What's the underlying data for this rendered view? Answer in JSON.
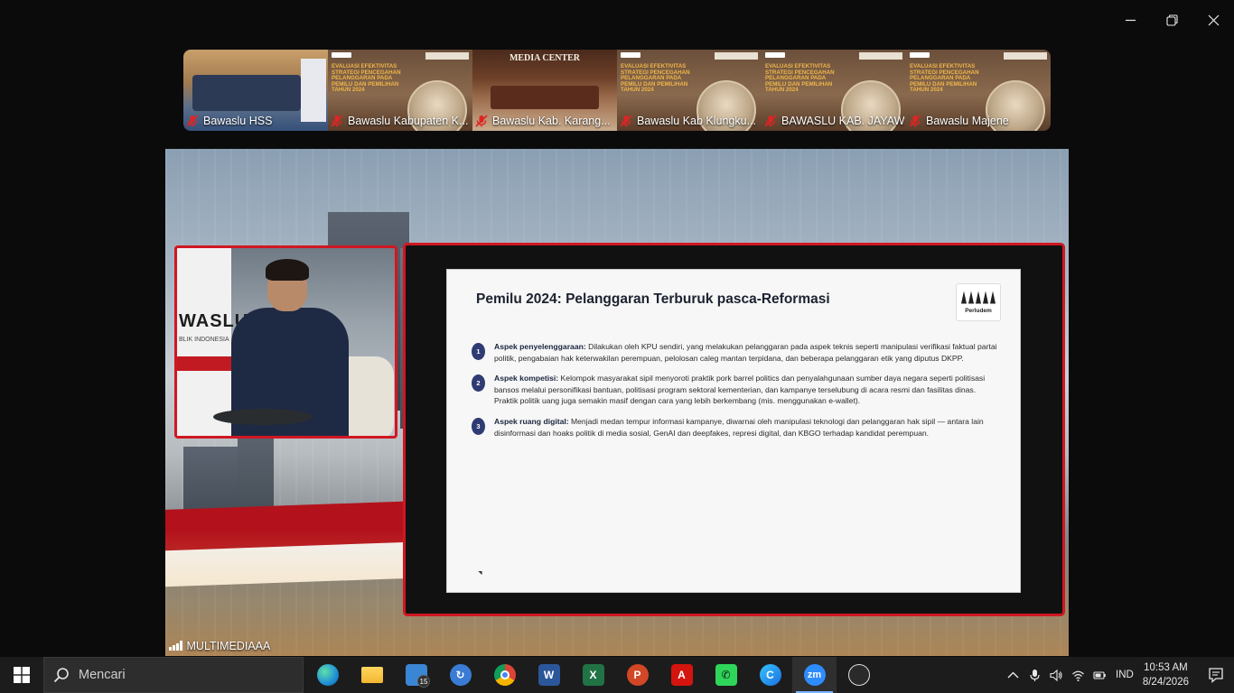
{
  "window": {
    "minimize_icon": "minimize-icon",
    "restore_icon": "restore-icon",
    "close_icon": "close-icon"
  },
  "participants": [
    {
      "name": "Bawaslu HSS",
      "muted": true
    },
    {
      "name": "Bawaslu Kabupaten K...",
      "muted": true
    },
    {
      "name": "Bawaslu Kab. Karang...",
      "muted": true,
      "overlay": "MEDIA CENTER"
    },
    {
      "name": "Bawaslu Kab Klungku...",
      "muted": true
    },
    {
      "name": "BAWASLU KAB. JAYAW...",
      "muted": true
    },
    {
      "name": "Bawaslu Majene",
      "muted": true
    }
  ],
  "banner_text": "EVALUASI EFEKTIVITAS STRATEGI PENCEGAHAN PELANGGARAN PADA PEMILU DAN PEMILIHAN TAHUN 2024",
  "speaker_wall": {
    "title": "WASLU",
    "subtitle": "BLIK INDONESIA"
  },
  "slide": {
    "title": "Pemilu 2024: Pelanggaran Terburuk pasca-Reformasi",
    "logo_text": "Perludem",
    "points": [
      {
        "num": "1",
        "label": "Aspek penyelenggaraan:",
        "text": " Dilakukan oleh KPU sendiri, yang melakukan pelanggaran pada aspek teknis seperti manipulasi verifikasi faktual partai politik, pengabaian hak keterwakilan perempuan, pelolosan caleg mantan terpidana, dan beberapa pelanggaran etik yang diputus DKPP."
      },
      {
        "num": "2",
        "label": "Aspek kompetisi:",
        "text": " Kelompok masyarakat sipil menyoroti praktik pork barrel politics dan penyalahgunaan sumber daya negara seperti politisasi bansos melalui personifikasi bantuan, politisasi program sektoral kementerian, dan kampanye terselubung di acara resmi dan fasilitas dinas. Praktik politik uang juga semakin masif dengan cara yang lebih berkembang (mis. menggunakan e-wallet)."
      },
      {
        "num": "3",
        "label": "Aspek ruang digital:",
        "text": " Menjadi medan tempur informasi kampanye, diwarnai oleh manipulasi teknologi dan pelanggaran hak sipil — antara lain disinformasi dan hoaks politik di media sosial, GenAI dan deepfakes, represi digital, dan KBGO terhadap kandidat perempuan."
      }
    ]
  },
  "active_speaker": {
    "name": "MULTIMEDIAAA"
  },
  "taskbar": {
    "search_placeholder": "Mencari",
    "apps": [
      {
        "name": "edge",
        "color": "#1f8fd6",
        "glyph": "e"
      },
      {
        "name": "file-explorer",
        "color": "#f2b632",
        "glyph": ""
      },
      {
        "name": "task-manager",
        "color": "#3a86d4",
        "glyph": "",
        "badge": "15"
      },
      {
        "name": "sync-app",
        "color": "#3a7bd5",
        "glyph": "↻"
      },
      {
        "name": "chrome",
        "color": "#db4437",
        "glyph": ""
      },
      {
        "name": "word",
        "color": "#2b579a",
        "glyph": "W"
      },
      {
        "name": "excel",
        "color": "#217346",
        "glyph": "X"
      },
      {
        "name": "powerpoint",
        "color": "#d24726",
        "glyph": "P"
      },
      {
        "name": "acrobat",
        "color": "#d4140f",
        "glyph": "A"
      },
      {
        "name": "phone-app",
        "color": "#2fd55a",
        "glyph": "✆"
      },
      {
        "name": "c-app",
        "color": "#1b6fe0",
        "glyph": "C"
      },
      {
        "name": "zoom",
        "color": "#2d8cff",
        "glyph": "zm"
      },
      {
        "name": "obs",
        "color": "#3a3a3a",
        "glyph": "◉"
      }
    ],
    "language": "IND",
    "time": "10:53 AM",
    "date": "8/24/2026"
  }
}
